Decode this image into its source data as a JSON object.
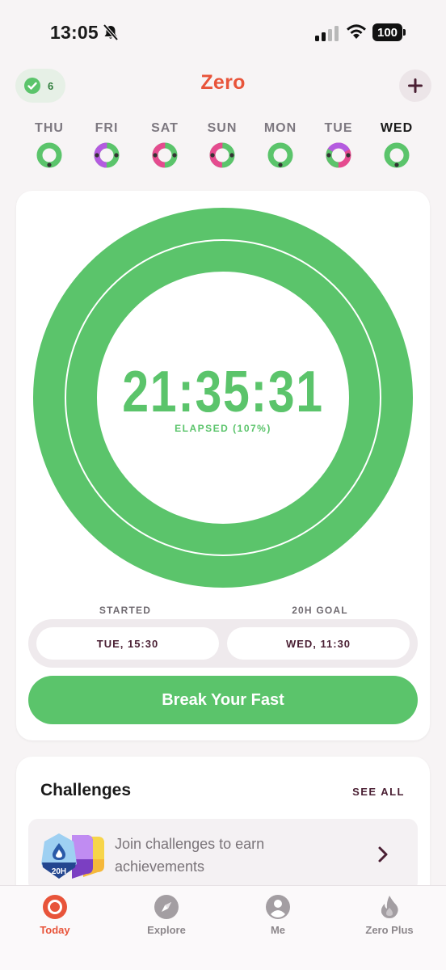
{
  "status_bar": {
    "time": "13:05",
    "battery": "100"
  },
  "header": {
    "streak_count": "6",
    "title": "Zero"
  },
  "week": [
    {
      "label": "THU",
      "today": false,
      "colors": [
        "#5bc46b"
      ]
    },
    {
      "label": "FRI",
      "today": false,
      "colors": [
        "#5bc46b",
        "#b45be0"
      ]
    },
    {
      "label": "SAT",
      "today": false,
      "colors": [
        "#5bc46b",
        "#e54b8f"
      ]
    },
    {
      "label": "SUN",
      "today": false,
      "colors": [
        "#5bc46b",
        "#e54b8f"
      ]
    },
    {
      "label": "MON",
      "today": false,
      "colors": [
        "#5bc46b"
      ]
    },
    {
      "label": "TUE",
      "today": false,
      "colors": [
        "#e54b8f",
        "#5bc46b",
        "#b45be0"
      ]
    },
    {
      "label": "WED",
      "today": true,
      "colors": [
        "#5bc46b"
      ]
    }
  ],
  "timer": {
    "elapsed": "21:35:31",
    "elapsed_label": "ELAPSED (107%)",
    "progress_fraction": 1.07,
    "started_label": "STARTED",
    "started_value": "TUE, 15:30",
    "goal_label": "20H GOAL",
    "goal_value": "WED, 11:30",
    "break_button": "Break Your Fast"
  },
  "challenges": {
    "title": "Challenges",
    "see_all": "SEE ALL",
    "prompt": "Join challenges to earn achievements",
    "badge_text": "20H"
  },
  "tabs": [
    {
      "label": "Today",
      "icon": "today-icon",
      "active": true
    },
    {
      "label": "Explore",
      "icon": "compass-icon",
      "active": false
    },
    {
      "label": "Me",
      "icon": "person-icon",
      "active": false
    },
    {
      "label": "Zero Plus",
      "icon": "flame-icon",
      "active": false
    }
  ],
  "colors": {
    "accent": "#e8543a",
    "green": "#5bc46b",
    "maroon": "#4a1f33"
  }
}
